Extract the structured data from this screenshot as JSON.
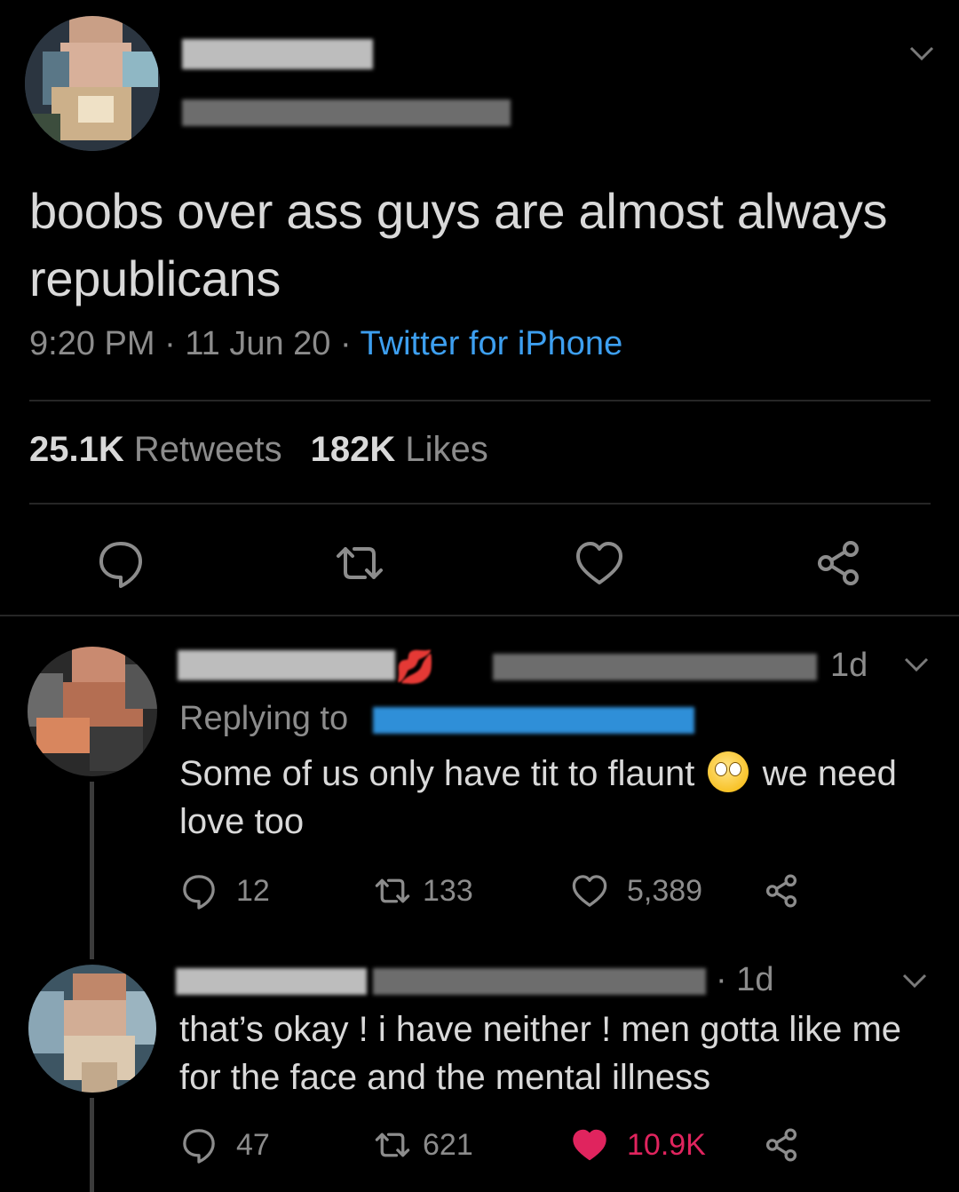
{
  "main_tweet": {
    "avatar": "profile-avatar (pixelated)",
    "display_name": "",
    "handle": "",
    "text": "boobs over ass guys are almost always republicans",
    "time": "9:20 PM",
    "date": "11 Jun 20",
    "source": "Twitter for iPhone",
    "separator": "·",
    "retweet_count": "25.1K",
    "retweet_label": "Retweets",
    "like_count": "182K",
    "like_label": "Likes",
    "icons": [
      "reply-icon",
      "retweet-icon",
      "heart-icon",
      "share-icon",
      "chevron-down-icon"
    ]
  },
  "replies": [
    {
      "display_name": "",
      "name_emoji": "💋",
      "time": "1d",
      "replying_label": "Replying to",
      "replying_to": "",
      "text_before_emoji": "Some of us only have tit to flaunt",
      "emoji": "🙄",
      "text_after_emoji": "we need love too",
      "reply_count": "12",
      "retweet_count": "133",
      "like_count": "5,389",
      "liked": false
    },
    {
      "display_name": "",
      "time": "· 1d",
      "text": "that’s okay ! i have neither ! men gotta like me for the face and the mental illness",
      "reply_count": "47",
      "retweet_count": "621",
      "like_count": "10.9K",
      "liked": true
    }
  ],
  "colors": {
    "background": "#000000",
    "text": "#d9d9d9",
    "muted": "#8c8c8c",
    "link": "#3d9ff0",
    "like": "#e0245e",
    "divider": "#262626"
  }
}
